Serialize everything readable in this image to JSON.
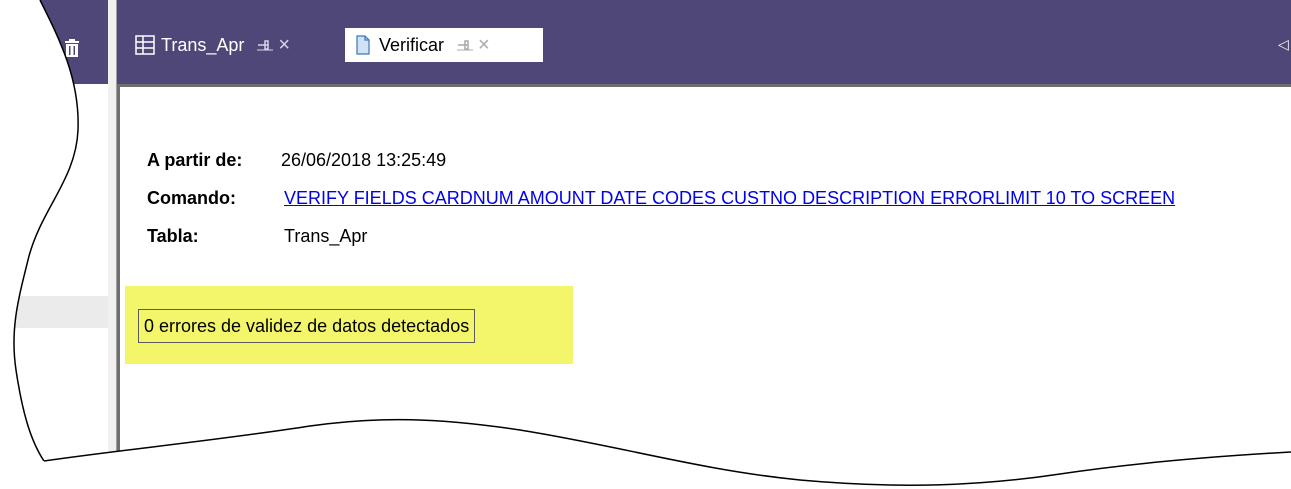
{
  "tabs": [
    {
      "label": "Trans_Apr",
      "icon": "table-icon",
      "active": false
    },
    {
      "label": "Verificar",
      "icon": "document-icon",
      "active": true
    }
  ],
  "tab_close_glyph": "×",
  "tab_overflow_glyph": "◁",
  "report": {
    "date_label": "A partir de:",
    "date_value": "26/06/2018 13:25:49",
    "command_label": "Comando:",
    "command_value": "VERIFY FIELDS CARDNUM AMOUNT DATE CODES CUSTNO DESCRIPTION ERRORLIMIT 10 TO SCREEN",
    "table_label": "Tabla:",
    "table_value": "Trans_Apr",
    "result": "0 errores de validez de datos detectados"
  },
  "colors": {
    "tab_strip": "#4f4778",
    "highlight": "#f3f56a",
    "link": "#0000ee"
  }
}
